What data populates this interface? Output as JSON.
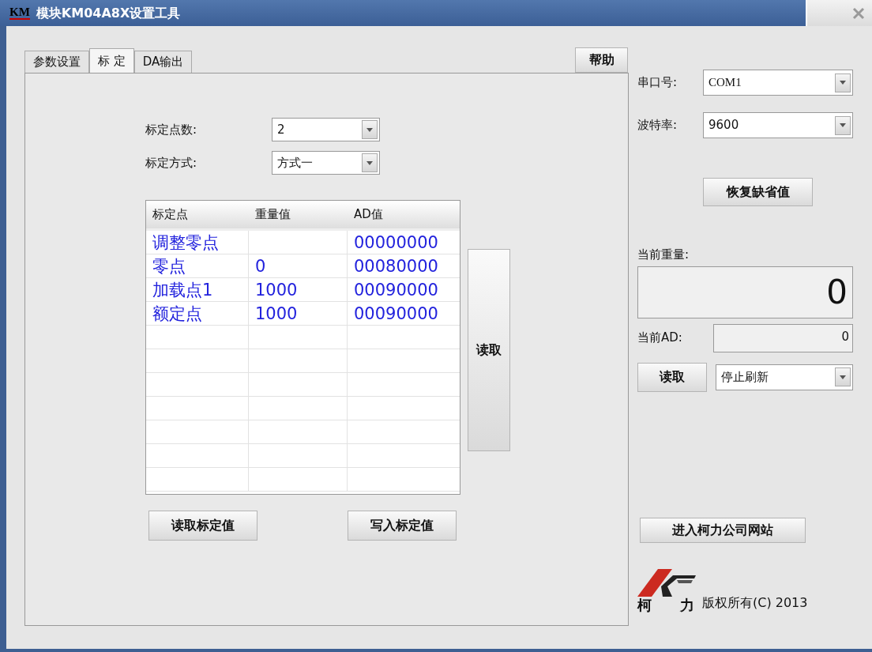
{
  "window": {
    "logo": "KM",
    "title": "模块KM04A8X设置工具"
  },
  "tabs": [
    {
      "label": "参数设置",
      "selected": false
    },
    {
      "label": "标 定",
      "selected": true
    },
    {
      "label": "DA输出",
      "selected": false
    }
  ],
  "help_button": "帮助",
  "calibration": {
    "points_label": "标定点数:",
    "points_value": "2",
    "method_label": "标定方式:",
    "method_value": "方式一"
  },
  "table": {
    "columns": [
      "标定点",
      "重量值",
      "AD值"
    ],
    "rows": [
      [
        "调整零点",
        "",
        "00000000"
      ],
      [
        "零点",
        "0",
        "00080000"
      ],
      [
        "加载点1",
        "1000",
        "00090000"
      ],
      [
        "额定点",
        "1000",
        "00090000"
      ]
    ]
  },
  "read_button": "读取",
  "read_calibration_button": "读取标定值",
  "write_calibration_button": "写入标定值",
  "serial": {
    "port_label": "串口号:",
    "port_value": "COM1",
    "baud_label": "波特率:",
    "baud_value": "9600"
  },
  "restore_defaults_button": "恢复缺省值",
  "current_weight": {
    "label": "当前重量:",
    "value": "0"
  },
  "current_ad": {
    "label": "当前AD:",
    "value": "0"
  },
  "read_now_button": "读取",
  "refresh_value": "停止刷新",
  "website_button": "进入柯力公司网站",
  "logo_text": [
    "柯",
    "力"
  ],
  "copyright": "版权所有(C) 2013"
}
